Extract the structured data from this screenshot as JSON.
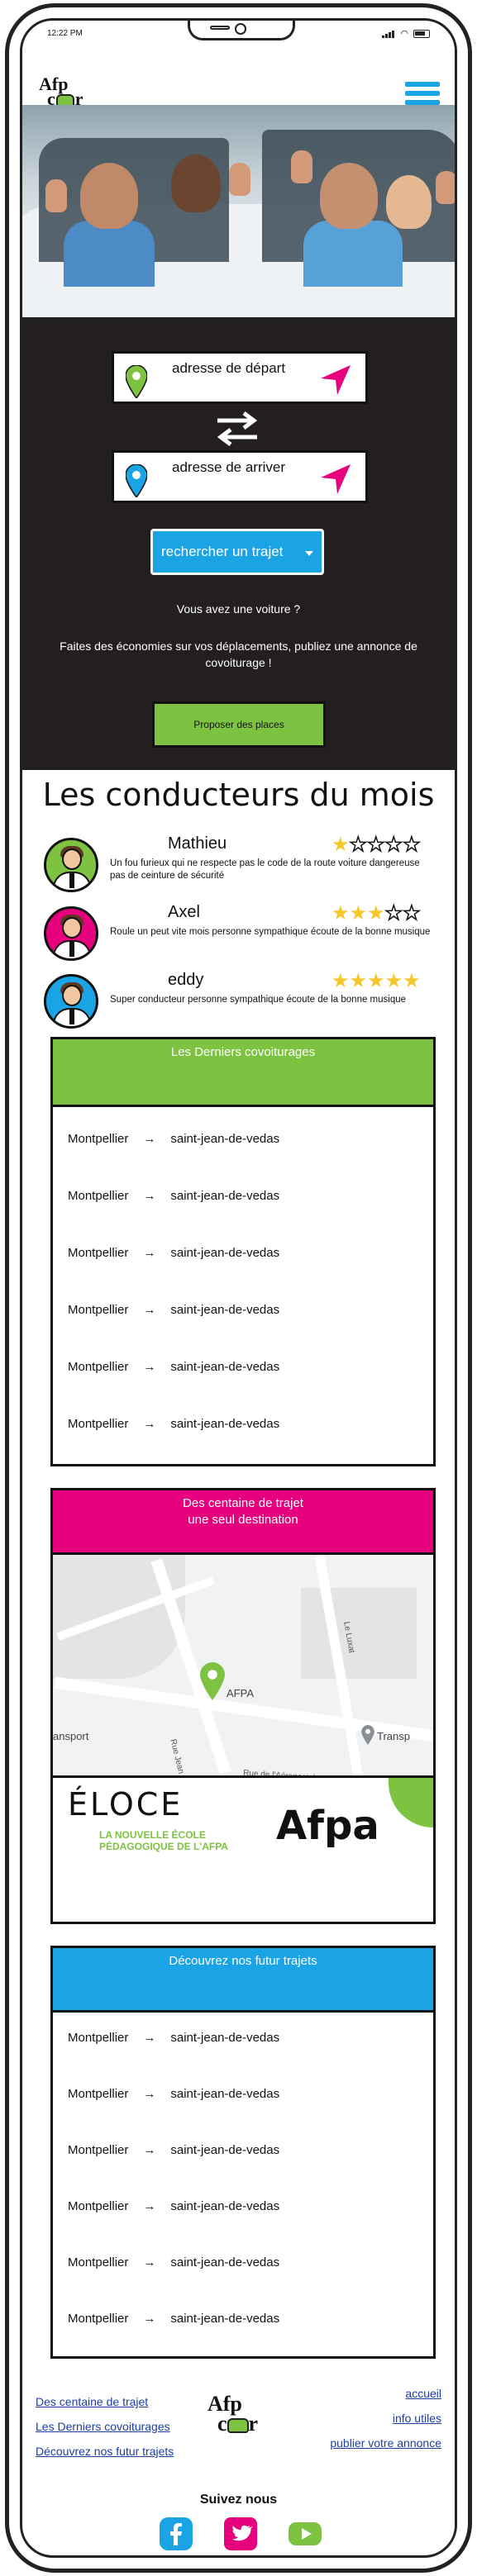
{
  "status": {
    "time": "12:22 PM"
  },
  "header": {
    "logo_top": "Afp",
    "logo_bottom_left": "c",
    "logo_bottom_right": "r"
  },
  "search": {
    "departure_label": "adresse de départ",
    "arrival_label": "adresse de arriver",
    "search_button": "rechercher un trajet",
    "question": "Vous avez une voiture ?",
    "pitch": "Faites des économies sur vos déplacements, publiez une annonce de covoiturage !",
    "propose_button": "Proposer des places"
  },
  "drivers": {
    "title": "Les conducteurs du mois",
    "items": [
      {
        "name": "Mathieu",
        "rating": 1,
        "max": 5,
        "desc": "Un fou furieux qui ne respecte pas le code de la route voiture dangereuse pas de ceinture de sécurité",
        "avatar_bg": "#7ec242"
      },
      {
        "name": "Axel",
        "rating": 3,
        "max": 5,
        "desc": "Roule un peut vite mois personne sympathique écoute de la bonne musique",
        "avatar_bg": "#e6007e"
      },
      {
        "name": "eddy",
        "rating": 5,
        "max": 5,
        "desc": "Super conducteur personne sympathique écoute de la bonne musique",
        "avatar_bg": "#1aa4e6"
      }
    ]
  },
  "latest": {
    "title": "Les Derniers covoiturages",
    "color": "#7ec242",
    "trips": [
      {
        "from": "Montpellier",
        "arrow": "→",
        "to": "saint-jean-de-vedas"
      },
      {
        "from": "Montpellier",
        "arrow": "→",
        "to": "saint-jean-de-vedas"
      },
      {
        "from": "Montpellier",
        "arrow": "→",
        "to": "saint-jean-de-vedas"
      },
      {
        "from": "Montpellier",
        "arrow": "→",
        "to": "saint-jean-de-vedas"
      },
      {
        "from": "Montpellier",
        "arrow": "→",
        "to": "saint-jean-de-vedas"
      },
      {
        "from": "Montpellier",
        "arrow": "→",
        "to": "saint-jean-de-vedas"
      }
    ]
  },
  "destination": {
    "title_line1": "Des centaine de trajet",
    "title_line2": "une seul destination",
    "color": "#e6007e",
    "map": {
      "pin_label": "AFPA",
      "left_label": "ansport",
      "right_label": "Transp",
      "road_label_1": "Rue de l'Aéropostale",
      "road_label_2": "Rue Jean Mermoz",
      "road_label_3": "Le Luxat"
    },
    "eloce_title": "ÉLOCE",
    "eloce_sub1": "LA NOUVELLE ÉCOLE",
    "eloce_sub2": "PÉDAGOGIQUE DE L'AFPA",
    "afpa": "Afpa"
  },
  "future": {
    "title": "Découvrez nos futur trajets",
    "color": "#1aa4e6",
    "trips": [
      {
        "from": "Montpellier",
        "arrow": "→",
        "to": "saint-jean-de-vedas"
      },
      {
        "from": "Montpellier",
        "arrow": "→",
        "to": "saint-jean-de-vedas"
      },
      {
        "from": "Montpellier",
        "arrow": "→",
        "to": "saint-jean-de-vedas"
      },
      {
        "from": "Montpellier",
        "arrow": "→",
        "to": "saint-jean-de-vedas"
      },
      {
        "from": "Montpellier",
        "arrow": "→",
        "to": "saint-jean-de-vedas"
      },
      {
        "from": "Montpellier",
        "arrow": "→",
        "to": "saint-jean-de-vedas"
      }
    ]
  },
  "footer": {
    "left_links": [
      "Des centaine de trajet",
      "Les Derniers covoiturages",
      "Découvrez nos futur trajets"
    ],
    "right_links": [
      "accueil",
      "info utiles",
      "publier votre annonce"
    ],
    "follow": "Suivez nous",
    "social": [
      "facebook-icon",
      "twitter-icon",
      "youtube-icon"
    ],
    "social_colors": [
      "#1aa4e6",
      "#e6007e",
      "#7ec242"
    ]
  },
  "colors": {
    "green": "#7ec242",
    "pink": "#e6007e",
    "blue": "#1aa4e6",
    "dark": "#231f20"
  }
}
